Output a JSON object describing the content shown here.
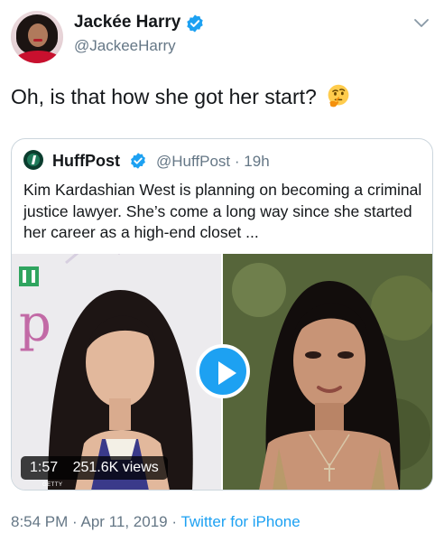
{
  "author": {
    "name": "Jackée Harry",
    "handle": "@JackeeHarry",
    "verified_icon": "verified-badge-icon"
  },
  "tweet": {
    "text": "Oh, is that how she got her start?",
    "emoji": "thinking-face-icon"
  },
  "quoted_tweet": {
    "name": "HuffPost",
    "handle": "@HuffPost",
    "separator": "·",
    "time": "19h",
    "text": "Kim Kardashian West is planning on becoming a criminal justice lawyer. She’s come a long way since she started her career as a high-end closet ...",
    "video": {
      "duration": "1:57",
      "views": "251.6K views",
      "credit": "GETTY"
    }
  },
  "footer": {
    "time": "8:54 PM",
    "separator": "·",
    "date": "Apr 11, 2019",
    "source": "Twitter for iPhone"
  },
  "colors": {
    "accent": "#1da1f2",
    "muted": "#657786",
    "text": "#14171a"
  }
}
